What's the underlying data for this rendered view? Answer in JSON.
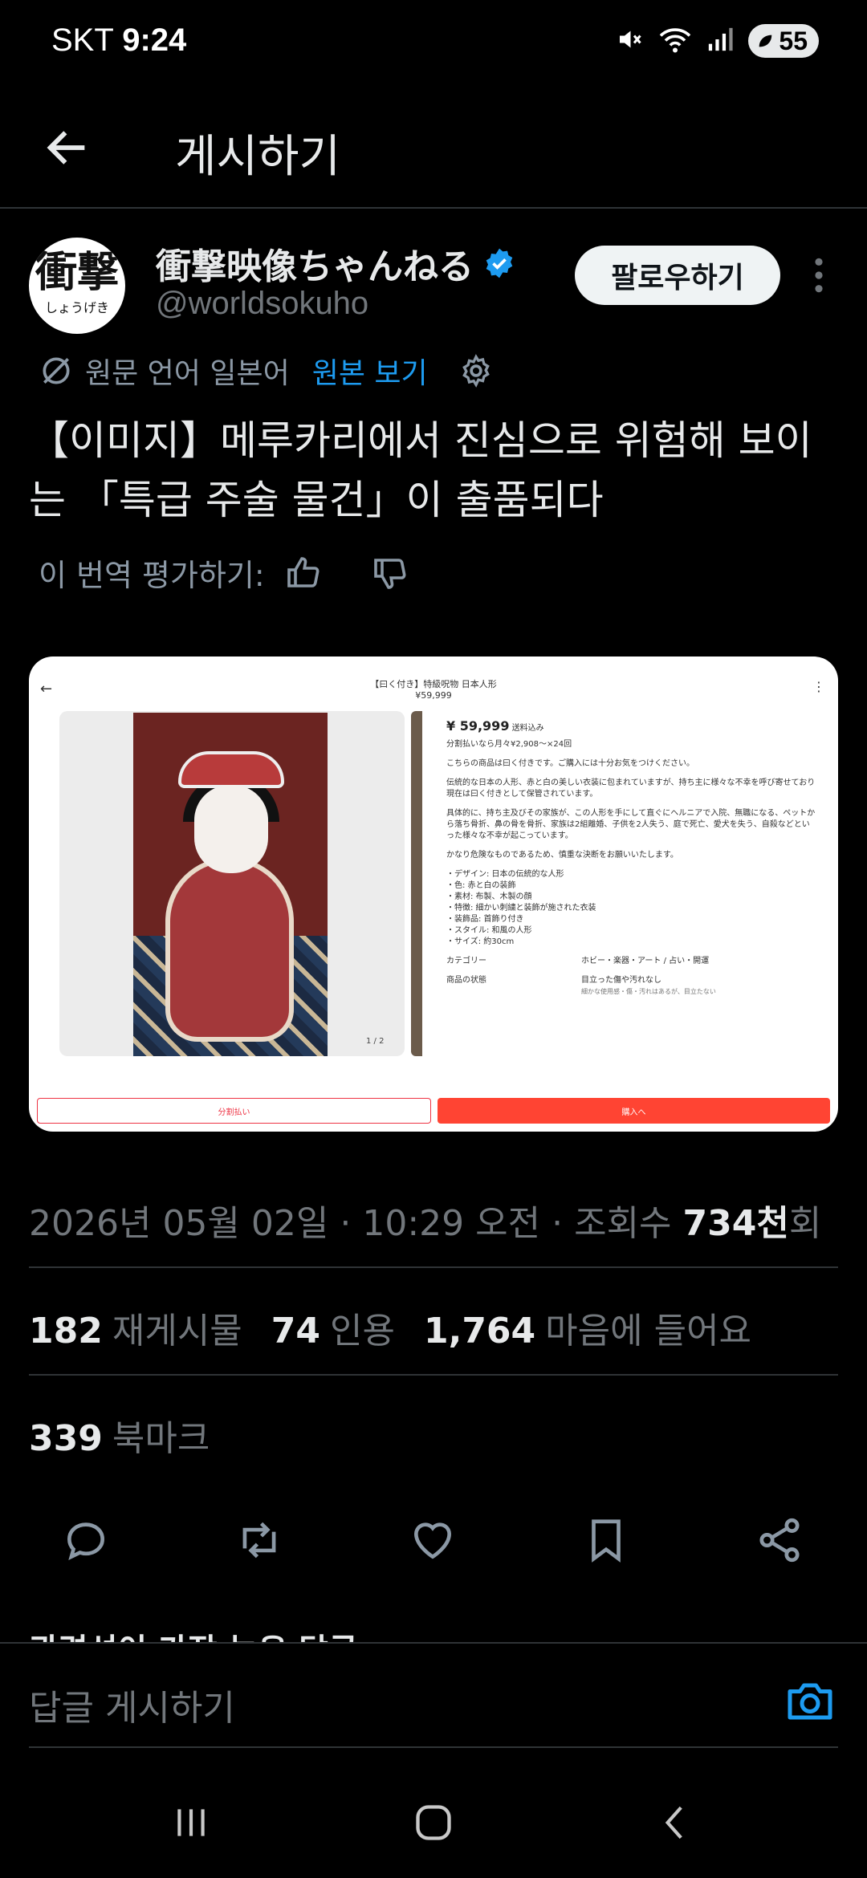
{
  "status_bar": {
    "carrier": "SKT",
    "time": "9:24",
    "battery": "55"
  },
  "header": {
    "title": "게시하기"
  },
  "author": {
    "avatar_kanji": "衝撃",
    "avatar_kana": "しょうげき",
    "name": "衝撃映像ちゃんねる",
    "handle": "@worldsokuho",
    "follow_label": "팔로우하기"
  },
  "translation": {
    "label": "원문 언어 일본어",
    "view_original": "원본 보기"
  },
  "tweet": {
    "text": "【이미지】메루카리에서 진심으로 위험해 보이는 「특급 주술 물건」이 출품되다"
  },
  "rate_translation": {
    "label": "이 번역 평가하기:"
  },
  "media": {
    "top_title": "【曰く付き】特級呪物 日本人形",
    "top_price": "¥59,999",
    "price": "¥ 59,999",
    "price_note": "送料込み",
    "installment": "分割払いなら月々¥2,908〜×24回",
    "paragraphs": [
      "こちらの商品は曰く付きです。ご購入には十分お気をつけください。",
      "伝統的な日本の人形、赤と白の美しい衣装に包まれていますが、持ち主に様々な不幸を呼び寄せており現在は曰く付きとして保管されています。",
      "具体的に、持ち主及びその家族が、この人形を手にして直ぐにヘルニアで入院、無職になる、ペットから落ち骨折、鼻の骨を骨折、家族は2組離婚、子供を2人失う、庭で死亡、愛犬を失う、自殺などといった様々な不幸が起こっています。",
      "かなり危険なものであるため、慎重な決断をお願いいたします。",
      "・デザイン: 日本の伝統的な人形\n・色: 赤と白の装飾\n・素材: 布製、木製の顔\n・特徴: 細かい刺繍と装飾が施された衣装\n・装飾品: 首飾り付き\n・スタイル: 和風の人形\n・サイズ: 約30cm"
    ],
    "category_key": "カテゴリー",
    "category_value": "ホビー・楽器・アート / 占い・開運",
    "condition_key": "商品の状態",
    "condition_value": "目立った傷や汚れなし",
    "condition_note": "細かな使用感・傷・汚れはあるが、目立たない",
    "page_indicator": "1 / 2",
    "btn_installment": "分割払い",
    "btn_buy": "購入へ"
  },
  "meta": {
    "date": "2026년 05월 02일",
    "time": "10:29 오전",
    "views_label": "조회수",
    "views_value": "734천",
    "views_suffix": "회"
  },
  "stats": {
    "reposts": "182",
    "reposts_label": "재게시물",
    "quotes": "74",
    "quotes_label": "인용",
    "likes": "1,764",
    "likes_label": "마음에 들어요",
    "bookmarks": "339",
    "bookmarks_label": "북마크"
  },
  "peek_text": "관련성이 가장 높은 답글",
  "reply": {
    "placeholder": "답글 게시하기"
  },
  "colors": {
    "accent": "#1d9bf0",
    "background": "#000000",
    "text": "#e7e9ea",
    "muted": "#71767b"
  }
}
